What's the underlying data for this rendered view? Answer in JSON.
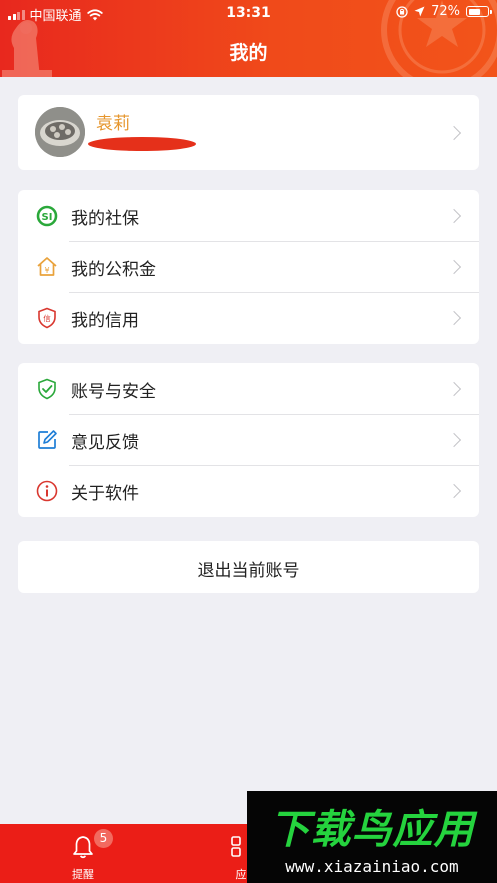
{
  "status_bar": {
    "carrier": "中国联通",
    "time": "13:31",
    "battery": "72%",
    "battery_level": 0.72
  },
  "header": {
    "title": "我的"
  },
  "profile": {
    "name": "袁莉"
  },
  "menu_group_1": [
    {
      "label": "我的社保",
      "icon": "social-security-icon",
      "color": "#2aa83a"
    },
    {
      "label": "我的公积金",
      "icon": "housing-fund-icon",
      "color": "#e9a23b"
    },
    {
      "label": "我的信用",
      "icon": "credit-shield-icon",
      "color": "#d9372f"
    }
  ],
  "menu_group_2": [
    {
      "label": "账号与安全",
      "icon": "security-shield-check-icon",
      "color": "#2aa83a"
    },
    {
      "label": "意见反馈",
      "icon": "feedback-edit-icon",
      "color": "#1f7ed6"
    },
    {
      "label": "关于软件",
      "icon": "info-icon",
      "color": "#d9372f"
    }
  ],
  "logout_label": "退出当前账号",
  "tabbar": {
    "remind_label": "提醒",
    "remind_badge": "5",
    "apps_label": "应"
  },
  "watermark": {
    "title": "下载鸟应用",
    "url": "www.xiazainiao.com"
  },
  "colors": {
    "header_red": "#e8281e",
    "tabbar_red": "#eb1e17",
    "username_orange": "#e6962d",
    "background": "#efeff4"
  }
}
